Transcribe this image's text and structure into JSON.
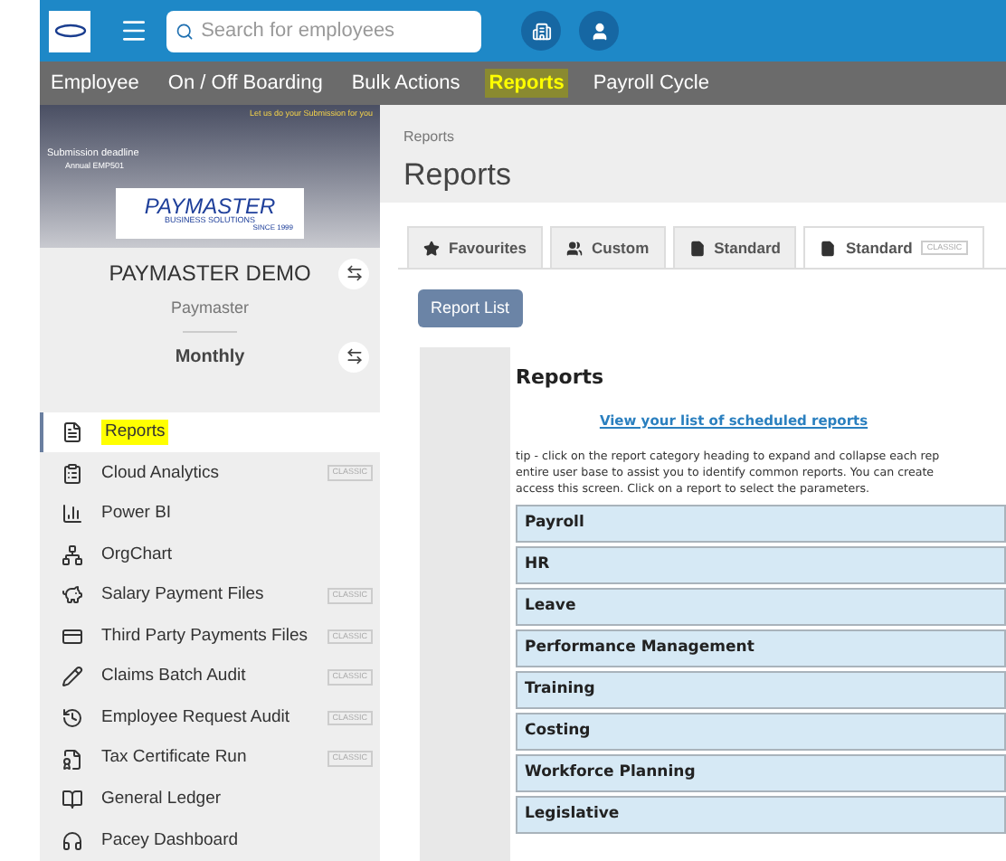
{
  "topbar": {
    "search": {
      "placeholder": "Search for employees"
    }
  },
  "nav": [
    {
      "label": "Employee",
      "selected": false
    },
    {
      "label": "On / Off Boarding",
      "selected": false
    },
    {
      "label": "Bulk Actions",
      "selected": false
    },
    {
      "label": "Reports",
      "selected": true
    },
    {
      "label": "Payroll Cycle",
      "selected": false
    }
  ],
  "banner": {
    "headline": "Submission deadline",
    "subline": "Annual EMP501",
    "cta": "Let us do your Submission for you"
  },
  "company": {
    "logo_name": "PAYMASTER",
    "logo_tag": "BUSINESS SOLUTIONS",
    "logo_since": "SINCE 1999",
    "name": "PAYMASTER DEMO",
    "subtitle": "Paymaster",
    "period": "Monthly"
  },
  "sidebar": {
    "items": [
      {
        "label": "Reports",
        "selected": true
      },
      {
        "label": "Cloud Analytics",
        "selected": false,
        "badge": "CLASSIC"
      },
      {
        "label": "Power BI",
        "selected": false
      },
      {
        "label": "OrgChart",
        "selected": false
      },
      {
        "label": "Salary Payment Files",
        "selected": false,
        "badge": "CLASSIC"
      },
      {
        "label": "Third Party Payments Files",
        "selected": false,
        "badge": "CLASSIC"
      },
      {
        "label": "Claims Batch Audit",
        "selected": false,
        "badge": "CLASSIC"
      },
      {
        "label": "Employee Request Audit",
        "selected": false,
        "badge": "CLASSIC"
      },
      {
        "label": "Tax Certificate Run",
        "selected": false,
        "badge": "CLASSIC"
      },
      {
        "label": "General Ledger",
        "selected": false
      },
      {
        "label": "Pacey Dashboard",
        "selected": false
      }
    ]
  },
  "main": {
    "breadcrumb": "Reports",
    "title": "Reports",
    "tabs": [
      {
        "label": "Favourites",
        "selected": false
      },
      {
        "label": "Custom",
        "selected": false
      },
      {
        "label": "Standard",
        "selected": false
      },
      {
        "label": "Standard",
        "selected": true,
        "badge": "CLASSIC"
      }
    ],
    "report_list_button": "Report List",
    "panel": {
      "title": "Reports",
      "link": "View your list of scheduled reports",
      "tip_lines": [
        "tip - click on the report category heading to expand and collapse each rep",
        "entire user base to assist you to identify common reports. You can create",
        "access this screen. Click on a report to select the parameters."
      ],
      "categories": [
        "Payroll",
        "HR",
        "Leave",
        "Performance Management",
        "Training",
        "Costing",
        "Workforce Planning",
        "Legislative"
      ]
    }
  }
}
